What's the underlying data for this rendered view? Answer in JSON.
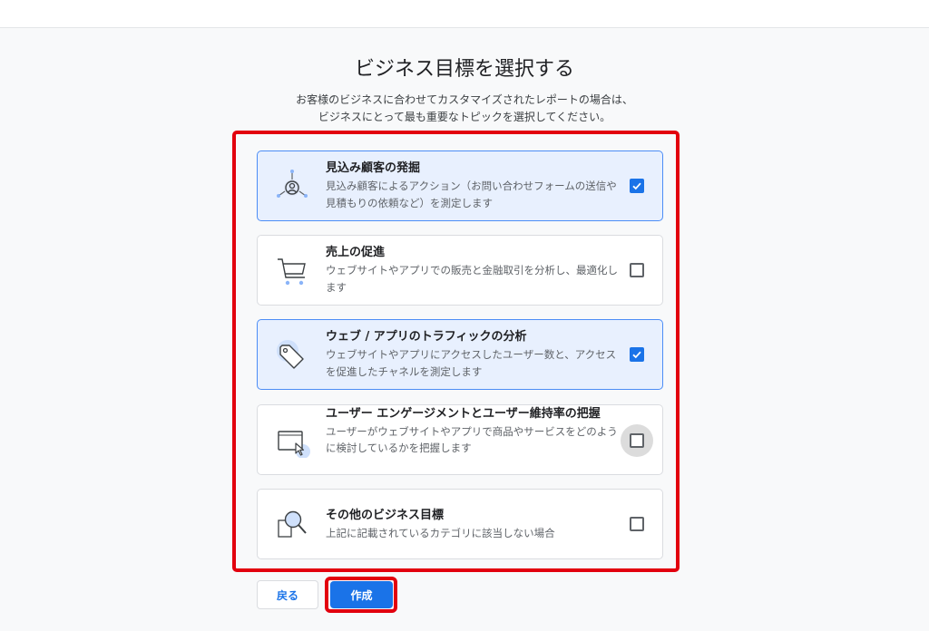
{
  "page": {
    "title": "ビジネス目標を選択する",
    "subtitle_line1": "お客様のビジネスに合わせてカスタマイズされたレポートの場合は、",
    "subtitle_line2": "ビジネスにとって最も重要なトピックを選択してください。"
  },
  "options": [
    {
      "title": "見込み顧客の発掘",
      "desc": "見込み顧客によるアクション（お問い合わせフォームの送信や見積もりの依頼など）を測定します",
      "checked": true,
      "icon": "lead-target-icon"
    },
    {
      "title": "売上の促進",
      "desc": "ウェブサイトやアプリでの販売と金融取引を分析し、最適化します",
      "checked": false,
      "icon": "shopping-cart-icon"
    },
    {
      "title": "ウェブ / アプリのトラフィックの分析",
      "desc": "ウェブサイトやアプリにアクセスしたユーザー数と、アクセスを促進したチャネルを測定します",
      "checked": true,
      "icon": "tag-icon"
    },
    {
      "title": "ユーザー エンゲージメントとユーザー維持率の把握",
      "desc": "ユーザーがウェブサイトやアプリで商品やサービスをどのように検討しているかを把握します",
      "checked": false,
      "icon": "screen-cursor-icon"
    },
    {
      "title": "その他のビジネス目標",
      "desc": "上記に記載されているカテゴリに該当しない場合",
      "checked": false,
      "icon": "magnifier-icon"
    }
  ],
  "buttons": {
    "back": "戻る",
    "create": "作成"
  },
  "colors": {
    "accent": "#1a73e8",
    "selected_bg": "#e8f0fe",
    "highlight_frame": "#e2000e"
  }
}
